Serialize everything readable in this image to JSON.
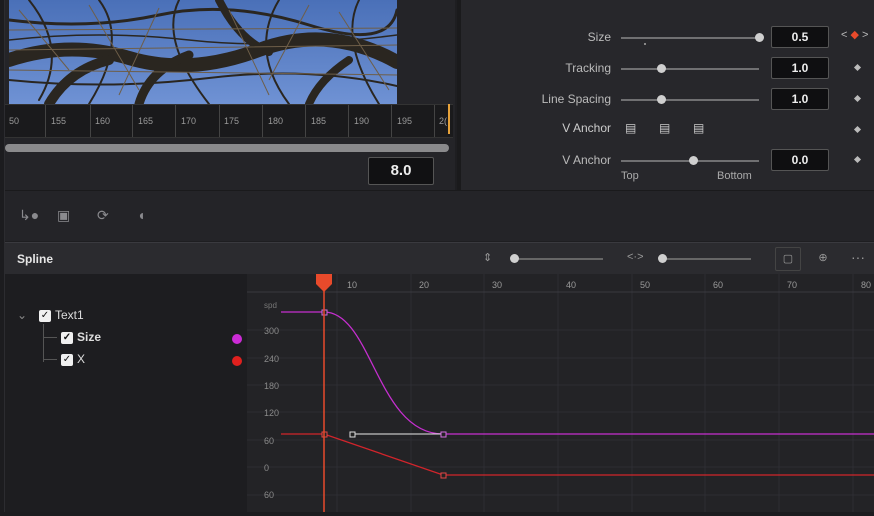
{
  "viewer": {
    "ruler_ticks": [
      "50",
      "155",
      "160",
      "165",
      "170",
      "175",
      "180",
      "185",
      "190",
      "195",
      "2("
    ],
    "current_frame": "8.0"
  },
  "inspector": {
    "rows": [
      {
        "label": "Size",
        "value": "0.5",
        "level": 1.0
      },
      {
        "label": "Tracking",
        "value": "1.0",
        "level": 0.27
      },
      {
        "label": "Line Spacing",
        "value": "1.0",
        "level": 0.27
      },
      {
        "label": "V Anchor"
      },
      {
        "label": "V Anchor",
        "value": "0.0",
        "level": 0.5
      }
    ],
    "keyframe_nav": {
      "prev": "<",
      "next": ">"
    },
    "anchor_sub": {
      "left": "Top",
      "right": "Bottom"
    }
  },
  "toolbar": {
    "icons": [
      "keyframe-ease-icon",
      "cube-icon",
      "spin-icon",
      "dome-icon"
    ]
  },
  "spline": {
    "title": "Spline",
    "tree": [
      {
        "label": "Text1",
        "checked": true,
        "level": 0
      },
      {
        "label": "Size",
        "checked": true,
        "level": 1,
        "color": "#cc2bd6"
      },
      {
        "label": "X",
        "checked": true,
        "level": 1,
        "color": "#e0201e"
      }
    ],
    "time_labels": [
      "10",
      "20",
      "30",
      "40",
      "50",
      "60",
      "70",
      "80"
    ],
    "value_labels": [
      "spd",
      "300",
      "240",
      "180",
      "120",
      "60",
      "0",
      "60"
    ],
    "more_label": "···"
  },
  "colors": {
    "size_curve": "#c62fd0",
    "x_curve": "#d2242b",
    "playhead": "#e84a2b"
  }
}
